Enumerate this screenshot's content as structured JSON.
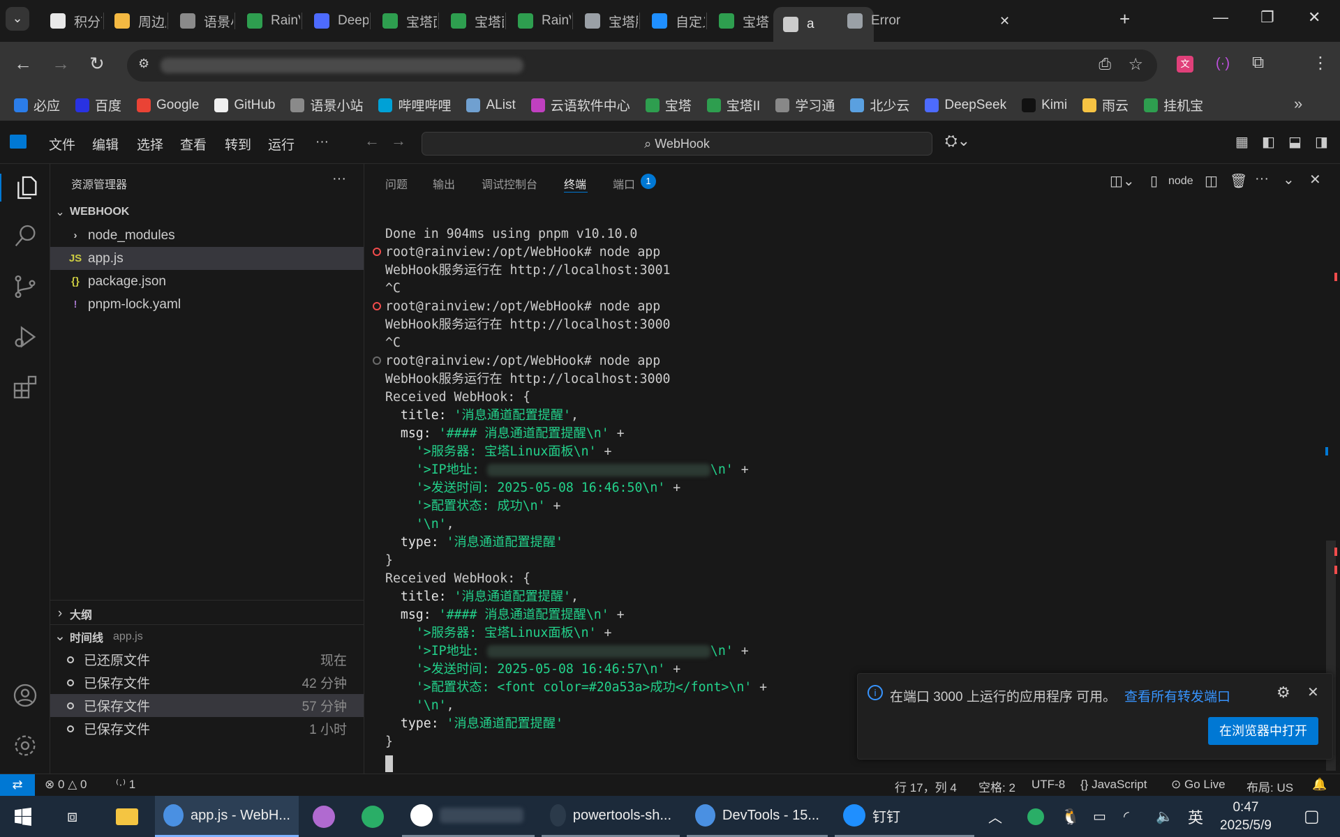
{
  "browser": {
    "tabs": [
      {
        "label": "积分商",
        "favicon_color": "#e8e8e8"
      },
      {
        "label": "周边产",
        "favicon_color": "#f4b942"
      },
      {
        "label": "语景小",
        "favicon_color": "#8a8a8a"
      },
      {
        "label": "RainV",
        "favicon_color": "#2e9e4f"
      },
      {
        "label": "Deep",
        "favicon_color": "#4d6bfe"
      },
      {
        "label": "宝塔面",
        "favicon_color": "#2e9e4f"
      },
      {
        "label": "宝塔面",
        "favicon_color": "#2e9e4f"
      },
      {
        "label": "RainV",
        "favicon_color": "#2e9e4f"
      },
      {
        "label": "宝塔服",
        "favicon_color": "#9aa0a6"
      },
      {
        "label": "自定义",
        "favicon_color": "#1f8fff"
      },
      {
        "label": "宝塔L",
        "favicon_color": "#2e9e4f"
      },
      {
        "label": "a",
        "favicon_color": "#cccccc"
      },
      {
        "label": "Error",
        "favicon_color": "#9aa0a6"
      }
    ],
    "bookmarks": [
      {
        "label": "必应",
        "icon": "search-icon",
        "color": "#2b7de9"
      },
      {
        "label": "百度",
        "icon": "baidu-icon",
        "color": "#2932e1"
      },
      {
        "label": "Google",
        "icon": "google-icon",
        "color": "#ea4335"
      },
      {
        "label": "GitHub",
        "icon": "github-icon",
        "color": "#f0f0f0"
      },
      {
        "label": "语景小站",
        "icon": "atom-icon",
        "color": "#8a8a8a"
      },
      {
        "label": "哔哩哔哩",
        "icon": "bilibili-icon",
        "color": "#00a1d6"
      },
      {
        "label": "AList",
        "icon": "alist-icon",
        "color": "#70a0d0"
      },
      {
        "label": "云语软件中心",
        "icon": "cloud-icon",
        "color": "#c040c0"
      },
      {
        "label": "宝塔",
        "icon": "bt-icon",
        "color": "#2e9e4f"
      },
      {
        "label": "宝塔II",
        "icon": "bt-icon",
        "color": "#2e9e4f"
      },
      {
        "label": "学习通",
        "icon": "study-icon",
        "color": "#888888"
      },
      {
        "label": "北少云",
        "icon": "cloud-icon",
        "color": "#5aa0e0"
      },
      {
        "label": "DeepSeek",
        "icon": "deepseek-icon",
        "color": "#4d6bfe"
      },
      {
        "label": "Kimi",
        "icon": "kimi-icon",
        "color": "#111111"
      },
      {
        "label": "雨云",
        "icon": "rain-icon",
        "color": "#f6c343"
      },
      {
        "label": "挂机宝",
        "icon": "bt-icon",
        "color": "#2e9e4f"
      }
    ]
  },
  "vscode": {
    "menu": [
      "文件",
      "编辑",
      "选择",
      "查看",
      "转到",
      "运行",
      "···"
    ],
    "command_center": "WebHook",
    "explorer_title": "资源管理器",
    "folder": "WEBHOOK",
    "files": [
      {
        "name": "node_modules",
        "type": "folder",
        "badge": "›",
        "badge_color": "#cccccc"
      },
      {
        "name": "app.js",
        "type": "js",
        "badge": "JS",
        "badge_color": "#cbcb41"
      },
      {
        "name": "package.json",
        "type": "json",
        "badge": "{}",
        "badge_color": "#cbcb41"
      },
      {
        "name": "pnpm-lock.yaml",
        "type": "yaml",
        "badge": "!",
        "badge_color": "#a074c4"
      }
    ],
    "outline": "大纲",
    "timeline": {
      "title": "时间线",
      "file": "app.js",
      "items": [
        {
          "label": "已还原文件",
          "time": "现在"
        },
        {
          "label": "已保存文件",
          "time": "42 分钟"
        },
        {
          "label": "已保存文件",
          "time": "57 分钟"
        },
        {
          "label": "已保存文件",
          "time": "1 小时"
        }
      ]
    },
    "panel_tabs": [
      "问题",
      "输出",
      "调试控制台",
      "终端",
      "端口"
    ],
    "ports_badge": "1",
    "terminal_name": "node",
    "terminal_lines": [
      {
        "t": "Done in 904ms using pnpm v10.10.0",
        "m": ""
      },
      {
        "t": "root@rainview:/opt/WebHook# node app",
        "m": "error"
      },
      {
        "t": "WebHook服务运行在 http://localhost:3001",
        "m": ""
      },
      {
        "t": "^C",
        "m": ""
      },
      {
        "t": "root@rainview:/opt/WebHook# node app",
        "m": "error"
      },
      {
        "t": "WebHook服务运行在 http://localhost:3000",
        "m": ""
      },
      {
        "t": "^C",
        "m": ""
      },
      {
        "t": "root@rainview:/opt/WebHook# node app",
        "m": "idle"
      },
      {
        "t": "WebHook服务运行在 http://localhost:3000",
        "m": ""
      },
      {
        "t": "Received WebHook: {",
        "m": ""
      },
      {
        "k": "  title: ",
        "s": "'消息通道配置提醒'",
        "e": ",",
        "m": ""
      },
      {
        "k": "  msg: ",
        "s": "'#### 消息通道配置提醒\\n'",
        "e": " +",
        "m": ""
      },
      {
        "k": "    ",
        "s": "'>服务器: 宝塔Linux面板\\n'",
        "e": " +",
        "m": ""
      },
      {
        "k": "    ",
        "s": "'>IP地址: ",
        "blur": true,
        "s2": "\\n'",
        "e": " +",
        "m": ""
      },
      {
        "k": "    ",
        "s": "'>发送时间: 2025-05-08 16:46:50\\n'",
        "e": " +",
        "m": ""
      },
      {
        "k": "    ",
        "s": "'>配置状态: 成功\\n'",
        "e": " +",
        "m": ""
      },
      {
        "k": "    ",
        "s": "'\\n'",
        "e": ",",
        "m": ""
      },
      {
        "k": "  type: ",
        "s": "'消息通道配置提醒'",
        "e": "",
        "m": ""
      },
      {
        "t": "}",
        "m": ""
      },
      {
        "t": "Received WebHook: {",
        "m": ""
      },
      {
        "k": "  title: ",
        "s": "'消息通道配置提醒'",
        "e": ",",
        "m": ""
      },
      {
        "k": "  msg: ",
        "s": "'#### 消息通道配置提醒\\n'",
        "e": " +",
        "m": ""
      },
      {
        "k": "    ",
        "s": "'>服务器: 宝塔Linux面板\\n'",
        "e": " +",
        "m": ""
      },
      {
        "k": "    ",
        "s": "'>IP地址: ",
        "blur": true,
        "s2": "\\n'",
        "e": " +",
        "m": ""
      },
      {
        "k": "    ",
        "s": "'>发送时间: 2025-05-08 16:46:57\\n'",
        "e": " +",
        "m": ""
      },
      {
        "k": "    ",
        "s": "'>配置状态: <font color=#20a53a>成功</font>\\n'",
        "e": " +",
        "m": ""
      },
      {
        "k": "    ",
        "s": "'\\n'",
        "e": ",",
        "m": ""
      },
      {
        "k": "  type: ",
        "s": "'消息通道配置提醒'",
        "e": "",
        "m": ""
      },
      {
        "t": "}",
        "m": ""
      }
    ],
    "notification": {
      "message": "在端口 3000 上运行的应用程序 可用。",
      "link": "查看所有转发端口",
      "button": "在浏览器中打开"
    },
    "status": {
      "errors": "0",
      "warnings": "0",
      "ports": "1",
      "cursor": "行 17，列 4",
      "spaces": "空格: 2",
      "encoding": "UTF-8",
      "language": "{} JavaScript",
      "golive": "Go Live",
      "layout": "布局: US"
    }
  },
  "taskbar": {
    "items": [
      {
        "label": "app.js - WebH...",
        "icon": "chrome-icon",
        "state": "active"
      },
      {
        "label": "",
        "icon": "cat-icon",
        "state": "none"
      },
      {
        "label": "",
        "icon": "wechat-icon",
        "state": "none"
      },
      {
        "label": "",
        "icon": "qq-icon",
        "state": "run"
      },
      {
        "label": "powertools-sh...",
        "icon": "terminal-icon",
        "state": "run"
      },
      {
        "label": "DevTools - 15...",
        "icon": "chrome-icon",
        "state": "run"
      },
      {
        "label": "钉钉",
        "icon": "dingtalk-icon",
        "state": "run"
      }
    ],
    "ime": "英",
    "time": "0:47",
    "date": "2025/5/9"
  },
  "colors": {
    "accent": "#0078d4",
    "string": "#23d18b",
    "error_marker": "#f14c4c"
  }
}
